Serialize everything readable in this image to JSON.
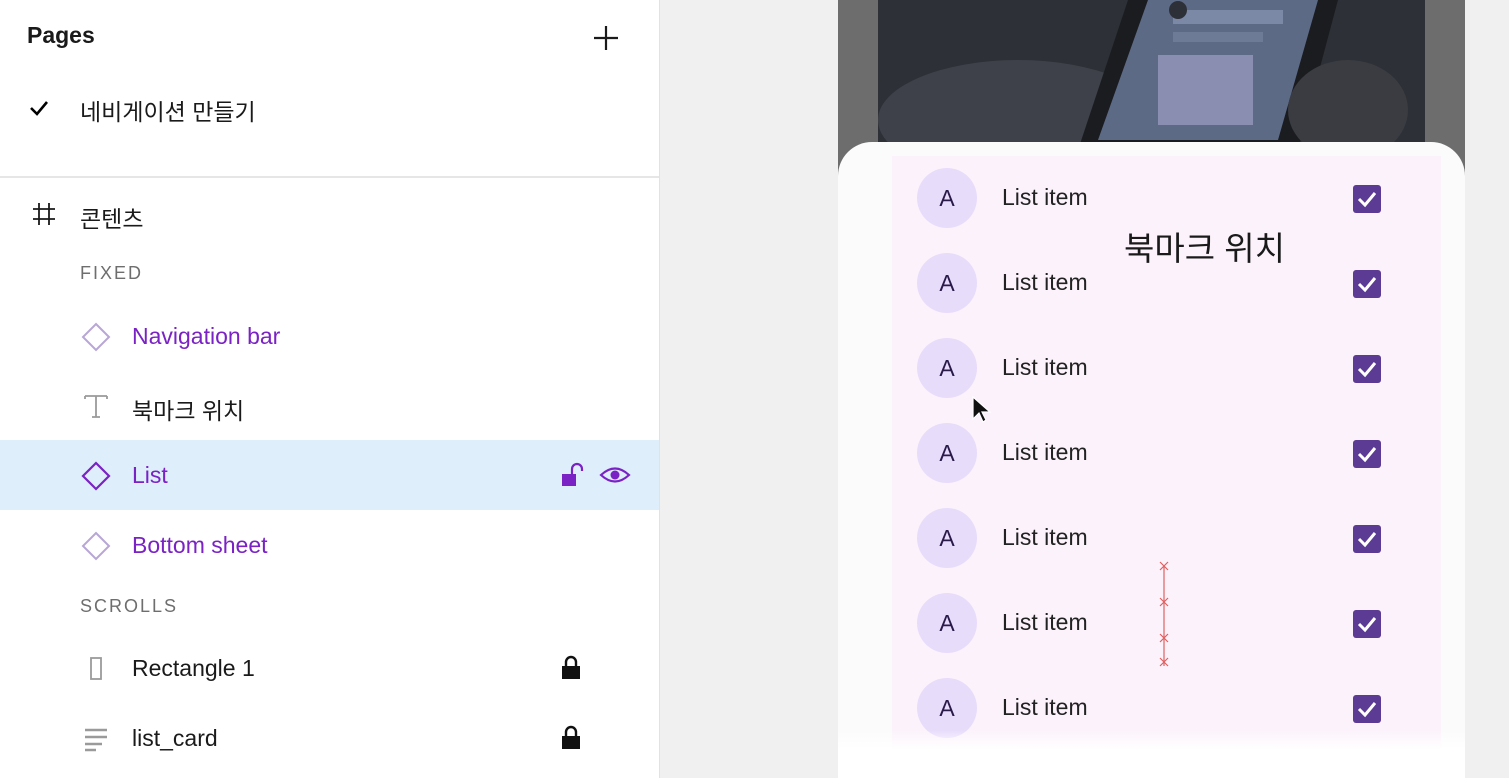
{
  "pages": {
    "header": "Pages",
    "items": [
      {
        "label": "네비게이션 만들기",
        "checked": true
      }
    ]
  },
  "frame": {
    "label": "콘텐츠"
  },
  "sections": {
    "fixed": "FIXED",
    "scrolls": "SCROLLS"
  },
  "layers": {
    "navigation_bar": "Navigation bar",
    "bookmark_text": "북마크 위치",
    "list": "List",
    "bottom_sheet": "Bottom sheet",
    "rectangle": "Rectangle 1",
    "list_card": "list_card"
  },
  "preview": {
    "bookmark_label": "북마크 위치",
    "list_items": [
      {
        "avatar": "A",
        "text": "List item",
        "checked": true
      },
      {
        "avatar": "A",
        "text": "List item",
        "checked": true
      },
      {
        "avatar": "A",
        "text": "List item",
        "checked": true
      },
      {
        "avatar": "A",
        "text": "List item",
        "checked": true
      },
      {
        "avatar": "A",
        "text": "List item",
        "checked": true
      },
      {
        "avatar": "A",
        "text": "List item",
        "checked": true
      },
      {
        "avatar": "A",
        "text": "List item",
        "checked": true
      }
    ]
  },
  "colors": {
    "component": "#7a22c4",
    "selection": "#deeefb",
    "checkbox": "#5b3b93",
    "avatar": "#e8dcfb",
    "list_bg": "#fcf2fb"
  }
}
